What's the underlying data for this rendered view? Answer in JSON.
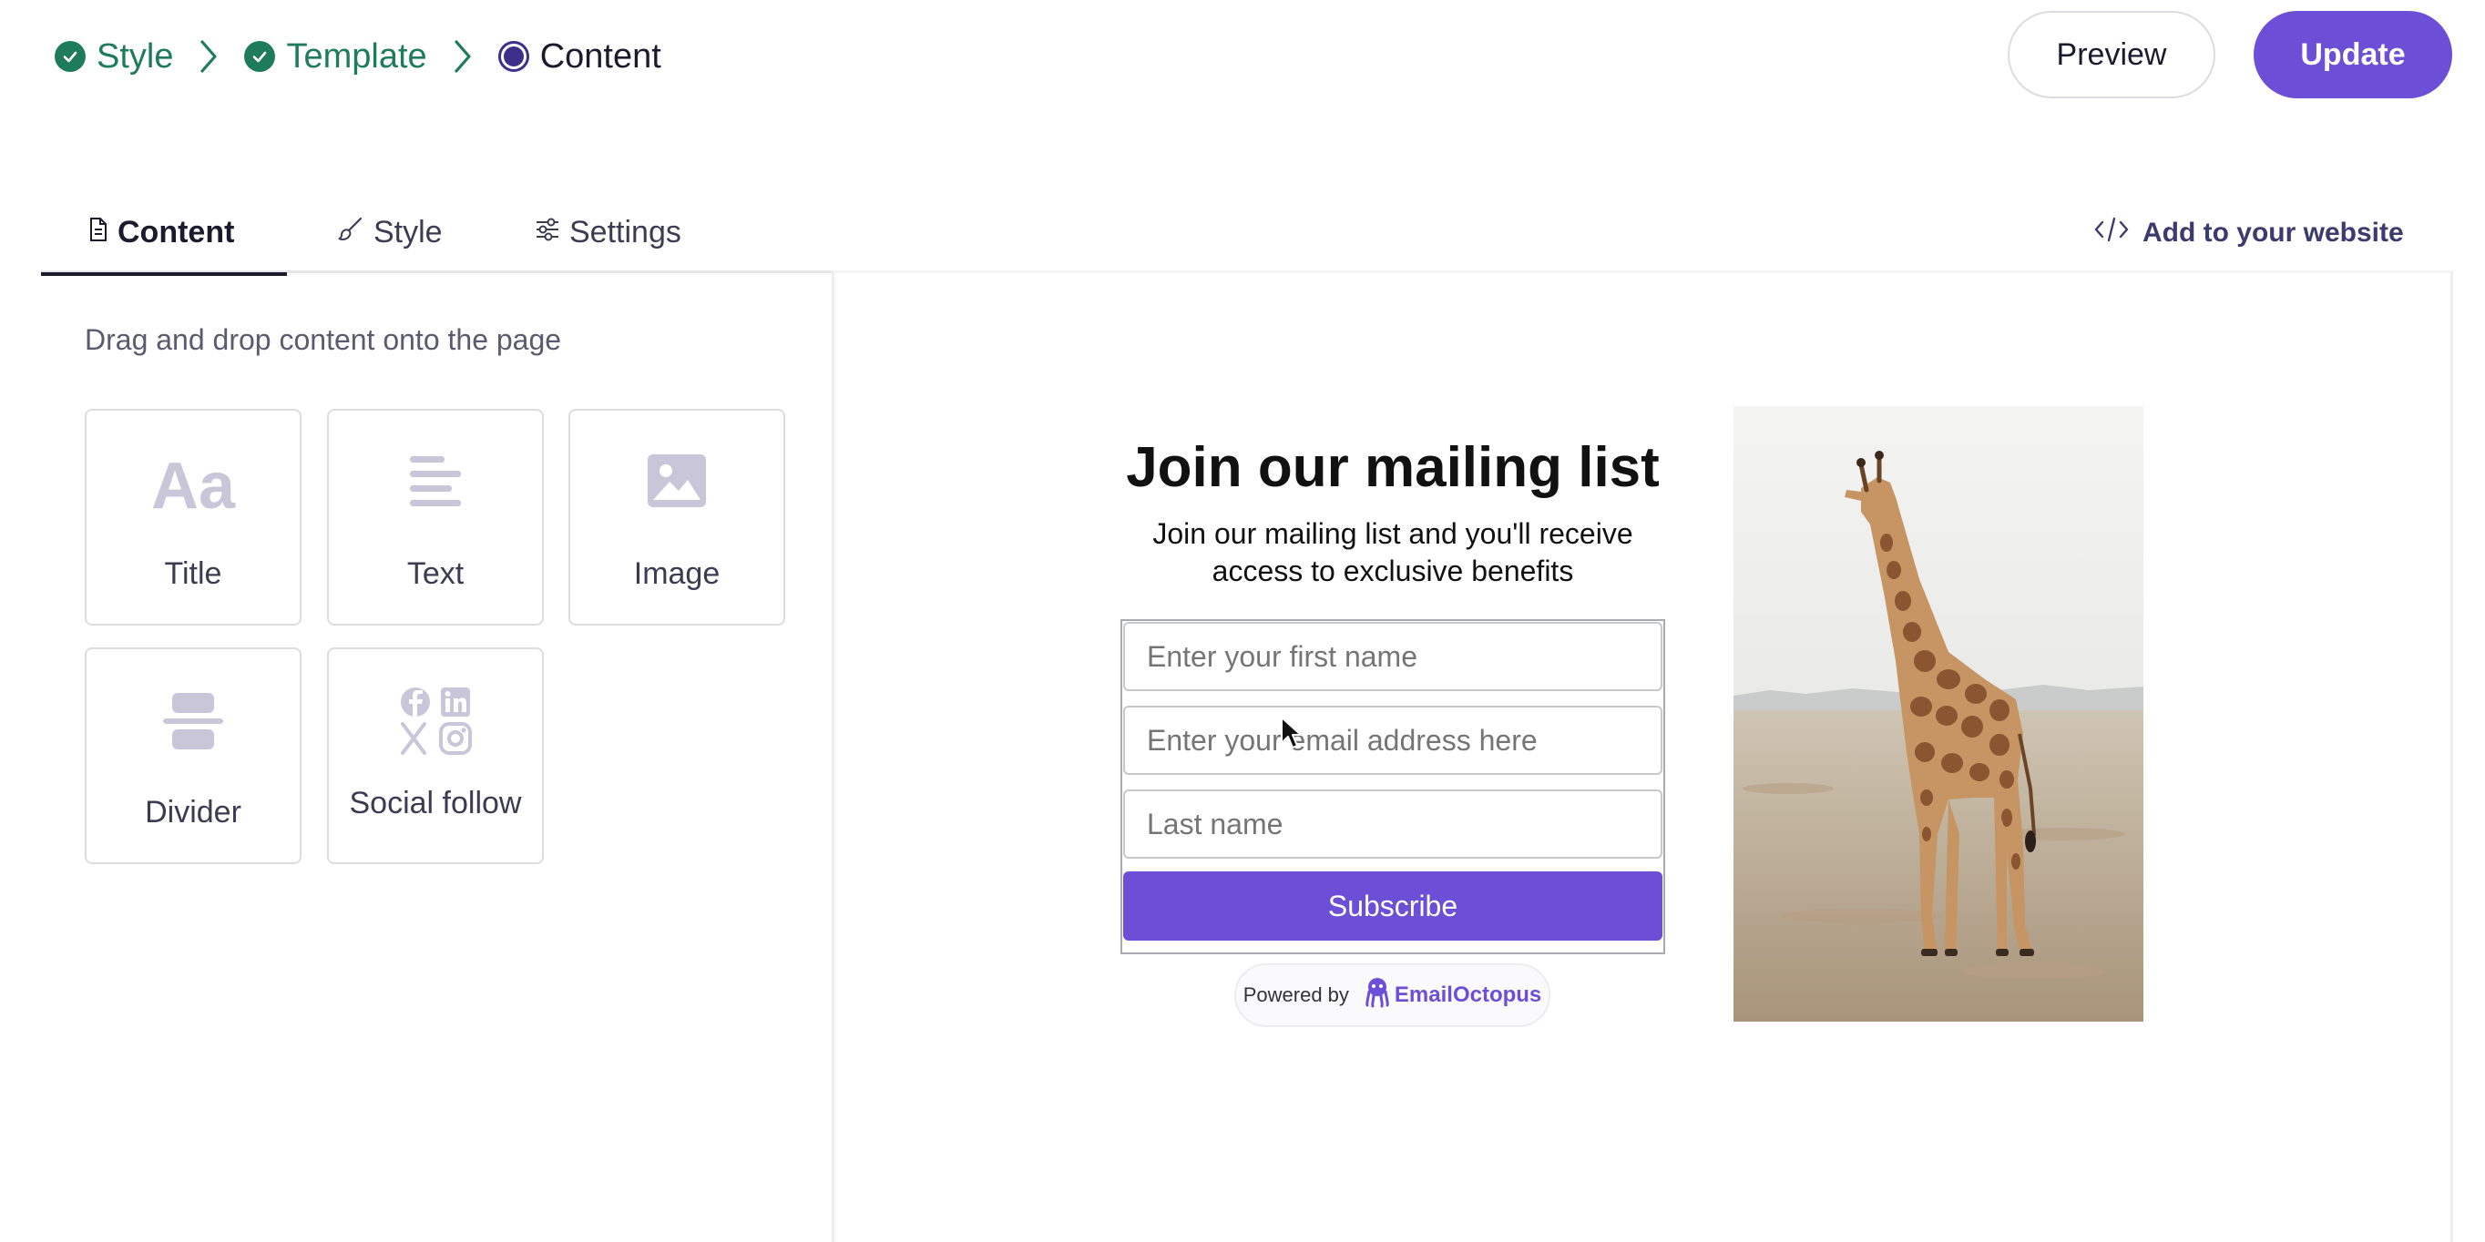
{
  "breadcrumb": {
    "steps": [
      {
        "label": "Style",
        "state": "done"
      },
      {
        "label": "Template",
        "state": "done"
      },
      {
        "label": "Content",
        "state": "current"
      }
    ]
  },
  "header": {
    "preview_label": "Preview",
    "update_label": "Update"
  },
  "tabs": [
    {
      "label": "Content",
      "icon": "document-icon",
      "active": true
    },
    {
      "label": "Style",
      "icon": "brush-icon",
      "active": false
    },
    {
      "label": "Settings",
      "icon": "sliders-icon",
      "active": false
    }
  ],
  "add_to_website_label": "Add to your website",
  "panel": {
    "hint": "Drag and drop content onto the page",
    "blocks": [
      {
        "label": "Title",
        "icon": "title-icon",
        "glyph": "Aa"
      },
      {
        "label": "Text",
        "icon": "text-lines-icon"
      },
      {
        "label": "Image",
        "icon": "image-icon"
      },
      {
        "label": "Divider",
        "icon": "divider-icon"
      },
      {
        "label": "Social follow",
        "icon": "social-icons"
      }
    ]
  },
  "form": {
    "title": "Join our mailing list",
    "subtitle_line1": "Join our mailing list and you'll receive",
    "subtitle_line2": "access to exclusive benefits",
    "fields": [
      {
        "placeholder": "Enter your first name"
      },
      {
        "placeholder": "Enter your email address here"
      },
      {
        "placeholder": "Last name"
      }
    ],
    "submit_label": "Subscribe",
    "powered_by": "Powered by",
    "brand": "EmailOctopus"
  },
  "colors": {
    "accent": "#6c4fd6",
    "success": "#1e7b5b",
    "current_step": "#3d2f8a"
  }
}
